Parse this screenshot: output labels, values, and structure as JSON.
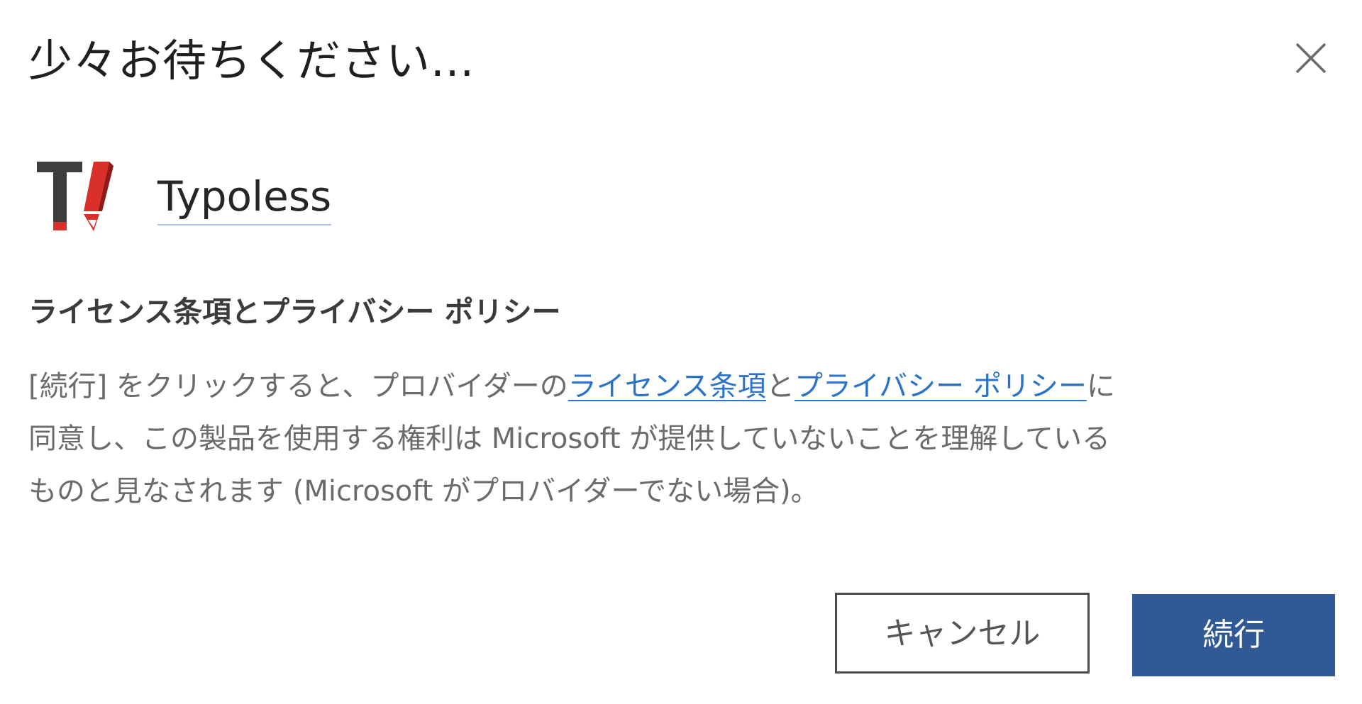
{
  "dialog": {
    "title": "少々お待ちください...",
    "close_icon": "close-icon"
  },
  "addin": {
    "logo_icon": "typoless-logo",
    "name": "Typoless",
    "logo_colors": {
      "dark": "#3d3d3d",
      "red": "#d9302a"
    }
  },
  "terms": {
    "heading": "ライセンス条項とプライバシー ポリシー",
    "text_part1": "[続行] をクリックすると、プロバイダーの",
    "license_link": "ライセンス条項",
    "text_part2": "と",
    "privacy_link": "プライバシー ポリシー",
    "text_part3": "に",
    "line2": "同意し、この製品を使用する権利は Microsoft が提供していないことを理解している",
    "line3": "ものと見なされます (Microsoft がプロバイダーでない場合)。"
  },
  "buttons": {
    "cancel_label": "キャンセル",
    "continue_label": "続行"
  },
  "colors": {
    "primary": "#315995",
    "link": "#2b73c9"
  }
}
